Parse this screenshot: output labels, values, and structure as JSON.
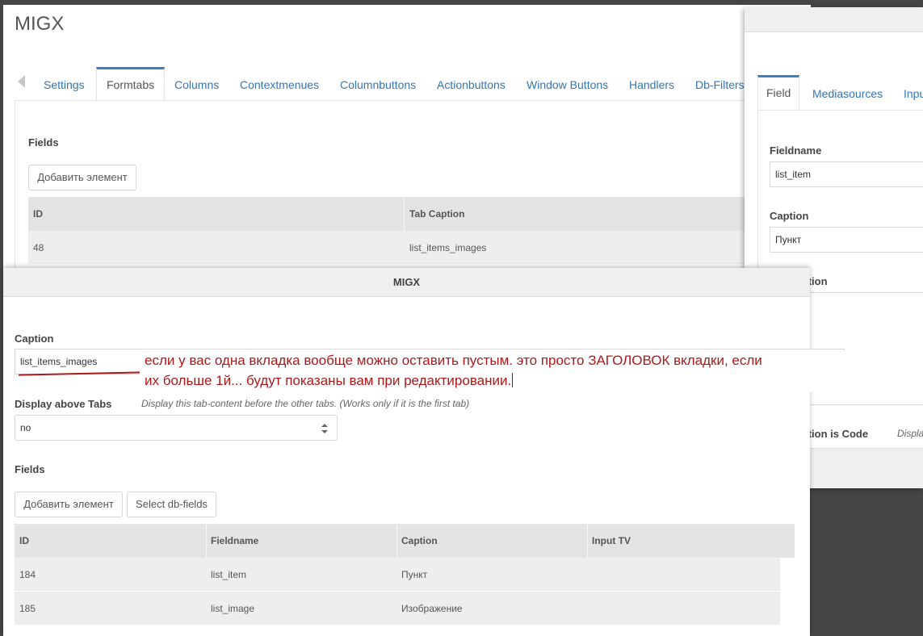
{
  "back_window": {
    "title": "MIGX",
    "tabs": [
      {
        "label": "Settings"
      },
      {
        "label": "Formtabs"
      },
      {
        "label": "Columns"
      },
      {
        "label": "Contextmenues"
      },
      {
        "label": "Columnbuttons"
      },
      {
        "label": "Actionbuttons"
      },
      {
        "label": "Window Buttons"
      },
      {
        "label": "Handlers"
      },
      {
        "label": "Db-Filters"
      }
    ],
    "active_tab": "Formtabs",
    "fields_label": "Fields",
    "add_button": "Добавить элемент",
    "grid": {
      "columns": [
        "ID",
        "Tab Caption"
      ],
      "rows": [
        [
          "48",
          "list_items_images"
        ]
      ]
    }
  },
  "front_window": {
    "title": "MIGX",
    "caption_label": "Caption",
    "caption_value": "list_items_images",
    "annotation": {
      "line1": "если у вас одна вкладка вообще можно оставить пустым. это просто ЗАГОЛОВОК вкладки, если",
      "line2": "их больше 1й... будут показаны вам при редактировании."
    },
    "display_above_label": "Display above Tabs",
    "display_above_hint": "Display this tab-content before the other tabs. (Works only if it is the first tab)",
    "display_above_value": "no",
    "fields_label": "Fields",
    "add_button": "Добавить элемент",
    "select_db_button": "Select db-fields",
    "grid": {
      "columns": [
        "ID",
        "Fieldname",
        "Caption",
        "Input TV"
      ],
      "rows": [
        [
          "184",
          "list_item",
          "Пункт",
          ""
        ],
        [
          "185",
          "list_image",
          "Изображение",
          ""
        ]
      ]
    }
  },
  "right_window": {
    "tabs": [
      {
        "label": "Field"
      },
      {
        "label": "Mediasources"
      },
      {
        "label": "Inpu"
      }
    ],
    "active_tab": "Field",
    "fieldname_label": "Fieldname",
    "fieldname_value": "list_item",
    "caption_label": "Caption",
    "caption_value": "Пункт",
    "description_label": "Description",
    "description_is_code_label": "Description is Code",
    "description_is_code_hint": "Displa"
  },
  "colors": {
    "annotation_red": "#b01818",
    "link_blue": "#3475b3",
    "active_tab_border": "#3a7fc1",
    "backdrop": "#454545"
  }
}
